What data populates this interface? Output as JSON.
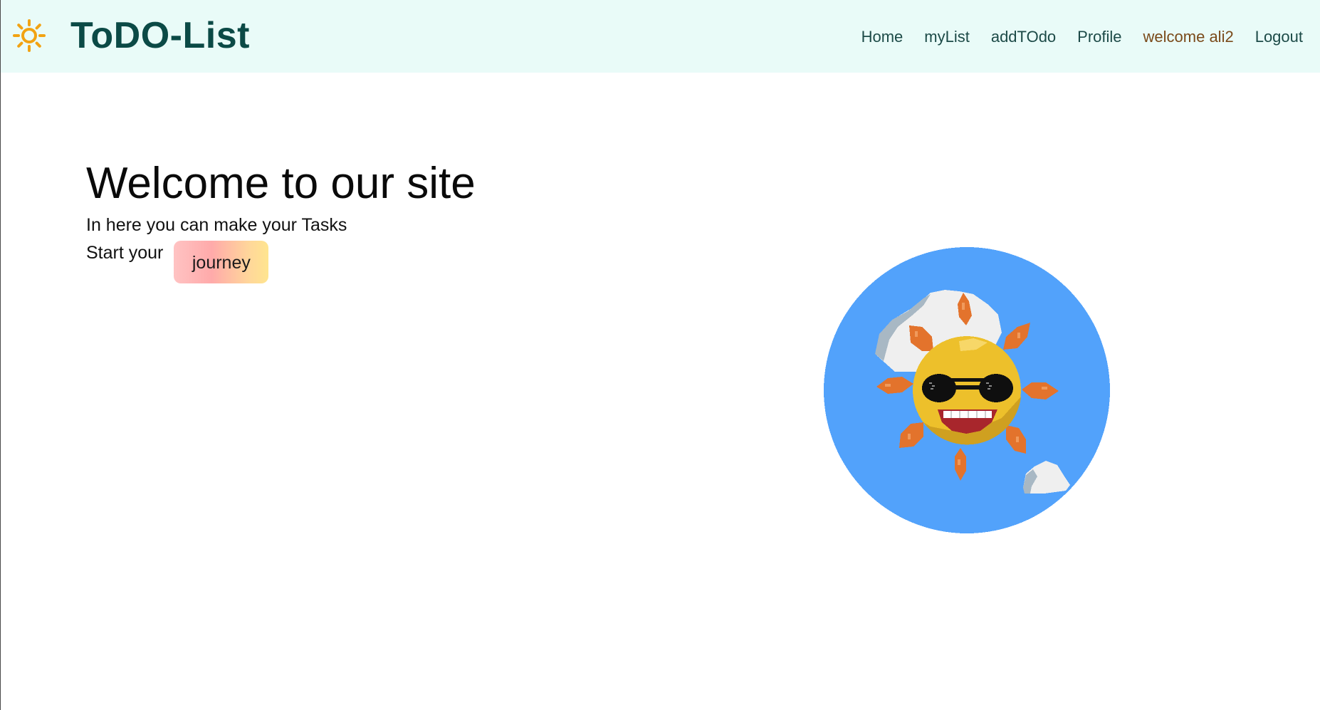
{
  "header": {
    "brand_title": "ToDO-List",
    "brand_icon": "sun-icon",
    "nav": [
      {
        "label": "Home"
      },
      {
        "label": "myList"
      },
      {
        "label": "addTOdo"
      },
      {
        "label": "Profile"
      },
      {
        "label": "welcome ali2"
      },
      {
        "label": "Logout"
      }
    ]
  },
  "hero": {
    "title": "Welcome to our site",
    "subtitle": "In here you can make your Tasks",
    "start_label": "Start your",
    "journey_button": "journey"
  },
  "illustration": {
    "icon": "cool-sun-with-sunglasses-illustration"
  },
  "colors": {
    "navbar_bg": "#e9fbf8",
    "brand": "#0b4a46",
    "nav_text": "#1c4a47",
    "welcome_text": "#7a4a1a",
    "illustration_bg": "#52a2fb",
    "sun_yellow": "#edc02b",
    "ray_orange": "#e3732c"
  }
}
